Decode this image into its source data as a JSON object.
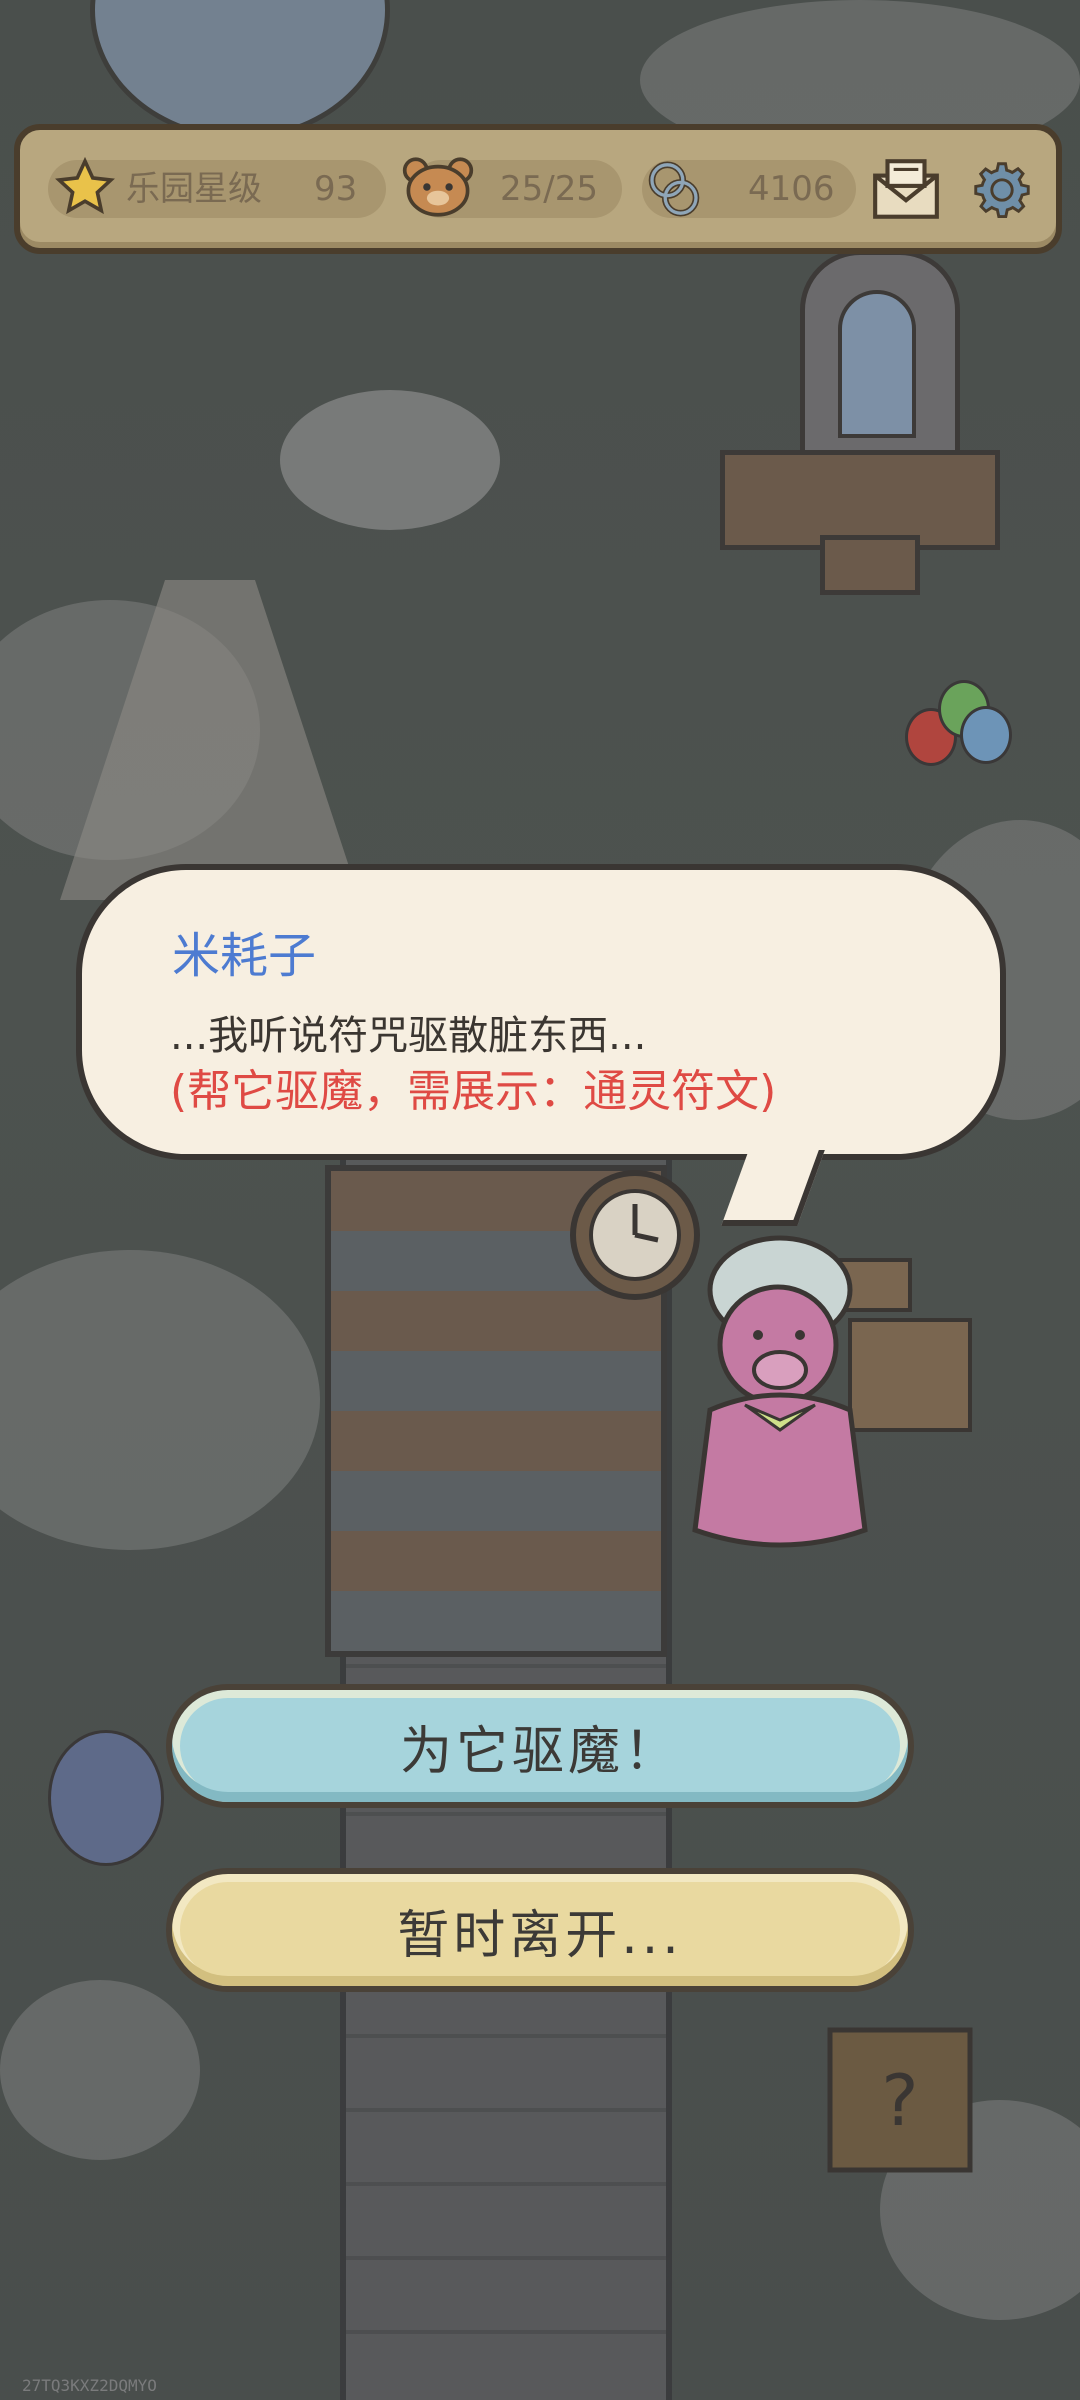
{
  "hud": {
    "star_label": "乐园星级",
    "star_value": "93",
    "bear_value": "25/25",
    "infinity_value": "4106",
    "icons": [
      "star-icon",
      "bear-icon",
      "infinity-icon",
      "mail-icon",
      "gear-icon"
    ]
  },
  "dialog": {
    "speaker": "米耗子",
    "line1": "...我听说符咒驱散脏东西...",
    "line2": "(帮它驱魔，需展示：通灵符文)"
  },
  "buttons": {
    "exorcise": "为它驱魔！",
    "leave": "暂时离开..."
  },
  "watermark": "27TQ3KXZ2DQMYO",
  "colors": {
    "speaker": "#4d7bd1",
    "hint": "#df4a44",
    "exorcise_button": "#a6d4dc",
    "leave_button": "#e9d9a0"
  }
}
